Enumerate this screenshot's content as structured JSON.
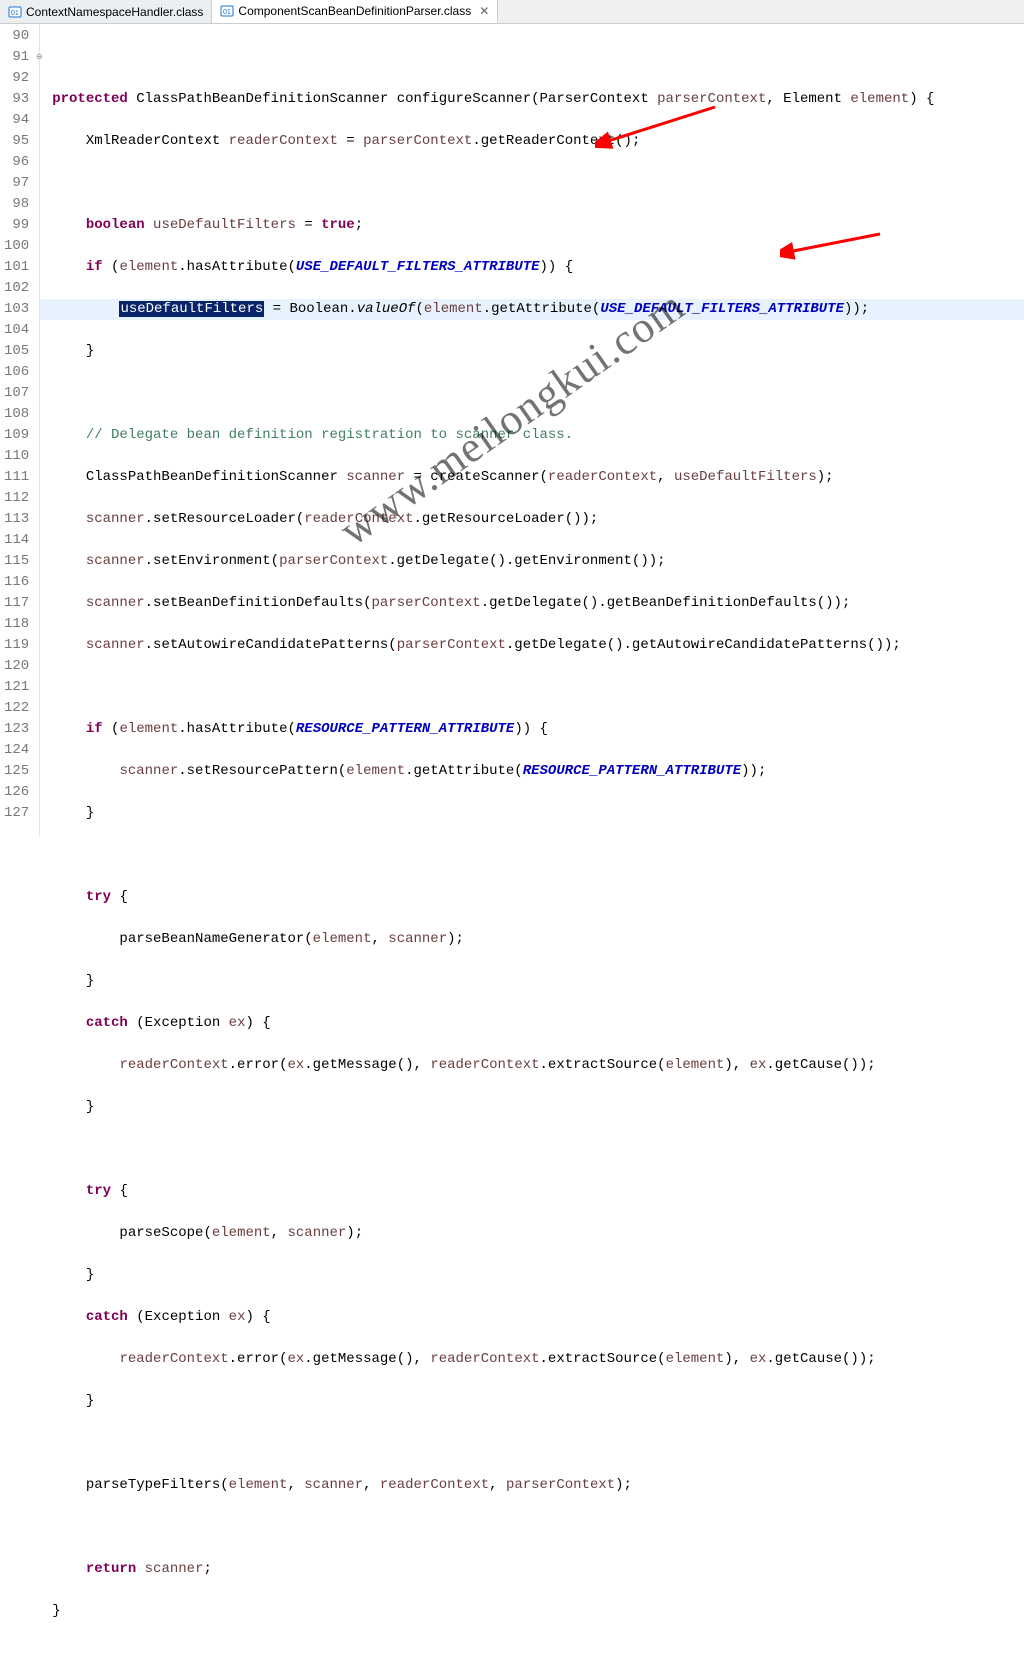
{
  "tabs": [
    {
      "label": "ContextNamespaceHandler.class",
      "active": false
    },
    {
      "label": "ComponentScanBeanDefinitionParser.class",
      "active": true
    }
  ],
  "gutter": [
    "90",
    "91",
    "92",
    "93",
    "94",
    "95",
    "96",
    "97",
    "98",
    "99",
    "100",
    "101",
    "102",
    "103",
    "104",
    "105",
    "106",
    "107",
    "108",
    "109",
    "110",
    "111",
    "112",
    "113",
    "114",
    "115",
    "116",
    "117",
    "118",
    "119",
    "120",
    "121",
    "122",
    "123",
    "124",
    "125",
    "126",
    "127"
  ],
  "code": {
    "sig_kw": "protected",
    "sig_ret": " ClassPathBeanDefinitionScanner configureScanner(ParserContext ",
    "sig_p1": "parserContext",
    "sig_m": ", Element ",
    "sig_p2": "element",
    "sig_end": ") {",
    "l92a": "    XmlReaderContext ",
    "l92v": "readerContext",
    "l92b": " = ",
    "l92c": "parserContext",
    "l92d": ".getReaderContext();",
    "l94a": "    ",
    "l94k": "boolean",
    "l94b": " ",
    "l94v": "useDefaultFilters",
    "l94c": " = ",
    "l94t": "true",
    "l94e": ";",
    "l95a": "    ",
    "l95k": "if",
    "l95b": " (",
    "l95v": "element",
    "l95c": ".hasAttribute(",
    "l95C": "USE_DEFAULT_FILTERS_ATTRIBUTE",
    "l95d": ")) {",
    "l96a": "        ",
    "l96sel": "useDefaultFilters",
    "l96b": " = Boolean.",
    "l96sm": "valueOf",
    "l96c": "(",
    "l96v": "element",
    "l96d": ".getAttribute(",
    "l96C": "USE_DEFAULT_FILTERS_ATTRIBUTE",
    "l96e": "));",
    "l97": "    }",
    "l99": "    // Delegate bean definition registration to scanner class.",
    "l100a": "    ClassPathBeanDefinitionScanner ",
    "l100v": "scanner",
    "l100b": " = createScanner(",
    "l100p1": "readerContext",
    "l100c": ", ",
    "l100p2": "useDefaultFilters",
    "l100d": ");",
    "l101a": "    ",
    "l101v": "scanner",
    "l101b": ".setResourceLoader(",
    "l101p": "readerContext",
    "l101c": ".getResourceLoader());",
    "l102a": "    ",
    "l102v": "scanner",
    "l102b": ".setEnvironment(",
    "l102p": "parserContext",
    "l102c": ".getDelegate().getEnvironment());",
    "l103a": "    ",
    "l103v": "scanner",
    "l103b": ".setBeanDefinitionDefaults(",
    "l103p": "parserContext",
    "l103c": ".getDelegate().getBeanDefinitionDefaults());",
    "l104a": "    ",
    "l104v": "scanner",
    "l104b": ".setAutowireCandidatePatterns(",
    "l104p": "parserContext",
    "l104c": ".getDelegate().getAutowireCandidatePatterns());",
    "l106a": "    ",
    "l106k": "if",
    "l106b": " (",
    "l106v": "element",
    "l106c": ".hasAttribute(",
    "l106C": "RESOURCE_PATTERN_ATTRIBUTE",
    "l106d": ")) {",
    "l107a": "        ",
    "l107v": "scanner",
    "l107b": ".setResourcePattern(",
    "l107p": "element",
    "l107c": ".getAttribute(",
    "l107C": "RESOURCE_PATTERN_ATTRIBUTE",
    "l107d": "));",
    "l108": "    }",
    "l110a": "    ",
    "l110k": "try",
    "l110b": " {",
    "l111a": "        parseBeanNameGenerator(",
    "l111p1": "element",
    "l111b": ", ",
    "l111p2": "scanner",
    "l111c": ");",
    "l112": "    }",
    "l113a": "    ",
    "l113k": "catch",
    "l113b": " (Exception ",
    "l113v": "ex",
    "l113c": ") {",
    "l114a": "        ",
    "l114v": "readerContext",
    "l114b": ".error(",
    "l114p": "ex",
    "l114c": ".getMessage(), ",
    "l114p2": "readerContext",
    "l114d": ".extractSource(",
    "l114p3": "element",
    "l114e": "), ",
    "l114p4": "ex",
    "l114f": ".getCause());",
    "l115": "    }",
    "l117a": "    ",
    "l117k": "try",
    "l117b": " {",
    "l118a": "        parseScope(",
    "l118p1": "element",
    "l118b": ", ",
    "l118p2": "scanner",
    "l118c": ");",
    "l119": "    }",
    "l120a": "    ",
    "l120k": "catch",
    "l120b": " (Exception ",
    "l120v": "ex",
    "l120c": ") {",
    "l121a": "        ",
    "l121v": "readerContext",
    "l121b": ".error(",
    "l121p": "ex",
    "l121c": ".getMessage(), ",
    "l121p2": "readerContext",
    "l121d": ".extractSource(",
    "l121p3": "element",
    "l121e": "), ",
    "l121p4": "ex",
    "l121f": ".getCause());",
    "l122": "    }",
    "l124a": "    parseTypeFilters(",
    "l124p1": "element",
    "l124b": ", ",
    "l124p2": "scanner",
    "l124c": ", ",
    "l124p3": "readerContext",
    "l124d": ", ",
    "l124p4": "parserContext",
    "l124e": ");",
    "l126a": "    ",
    "l126k": "return",
    "l126b": " ",
    "l126v": "scanner",
    "l126c": ";",
    "l127": "}"
  },
  "watermark": "www.meilongkui.com"
}
